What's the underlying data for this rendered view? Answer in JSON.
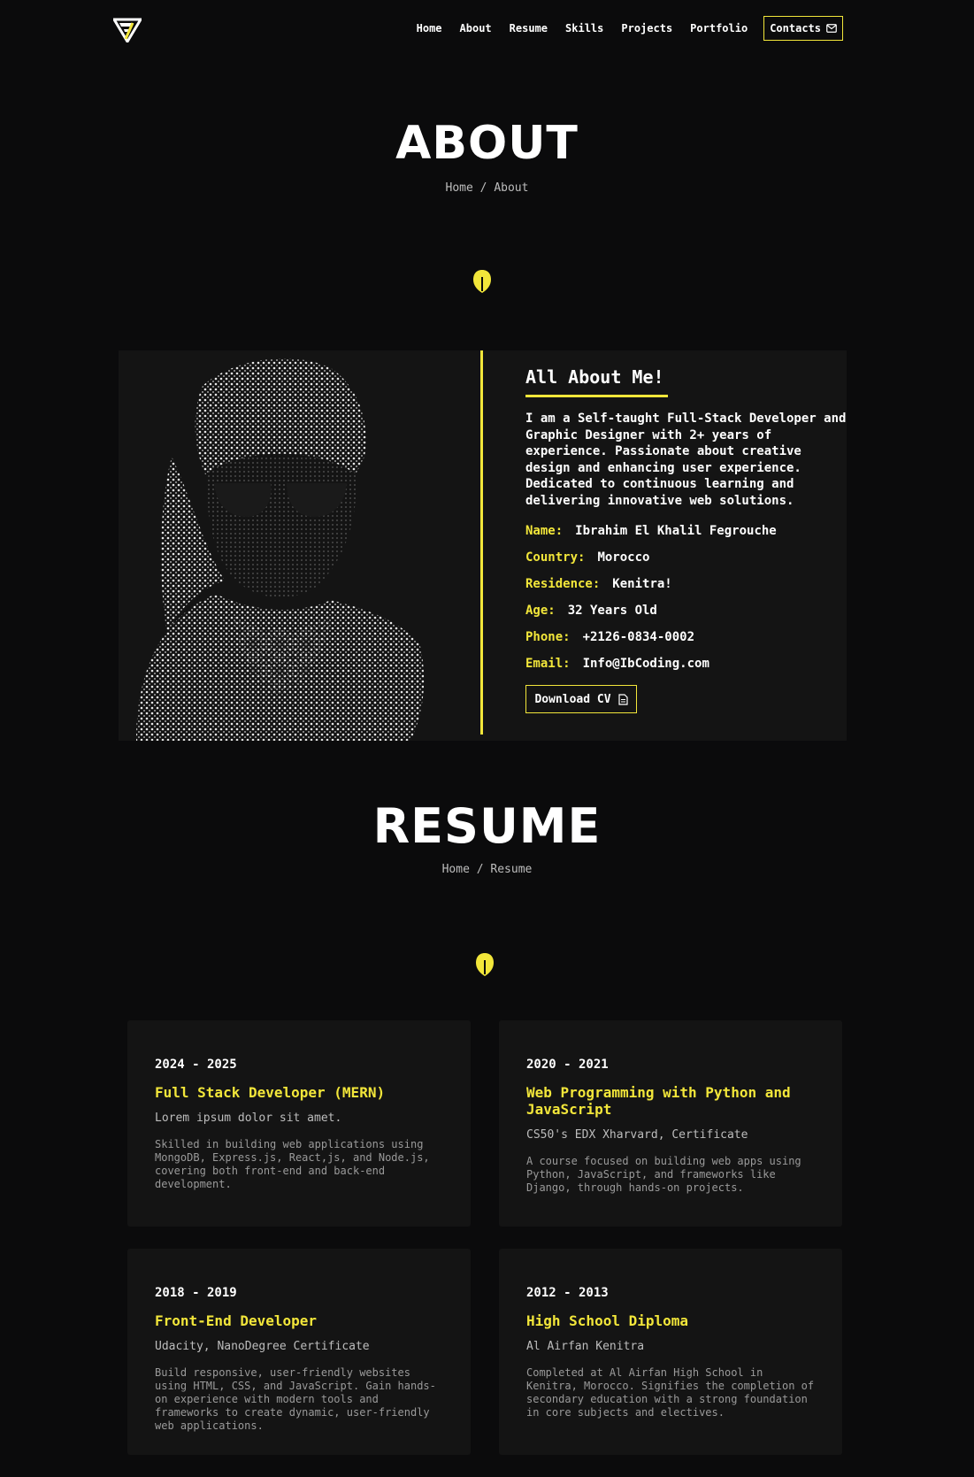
{
  "colors": {
    "accent": "#f2e63a",
    "background": "#0b0b0c",
    "card": "#141414"
  },
  "header": {
    "logo_icon": "fi-triangle-logo",
    "nav": [
      {
        "label": "Home"
      },
      {
        "label": "About"
      },
      {
        "label": "Resume"
      },
      {
        "label": "Skills"
      },
      {
        "label": "Projects"
      },
      {
        "label": "Portfolio"
      }
    ],
    "contacts": {
      "label": "Contacts",
      "icon": "mail-icon"
    }
  },
  "about_section": {
    "title": "ABOUT",
    "breadcrumb": {
      "home": "Home",
      "separator": "/",
      "current": "About"
    },
    "card": {
      "heading": "All About Me!",
      "description": "I am a Self-taught Full-Stack Developer and Graphic Designer with 2+ years of experience. Passionate about creative design and enhancing user experience. Dedicated to continuous learning and delivering innovative web solutions.",
      "info": [
        {
          "key": "Name:",
          "value": "Ibrahim El Khalil Fegrouche"
        },
        {
          "key": "Country:",
          "value": "Morocco"
        },
        {
          "key": "Residence:",
          "value": "Kenitra!"
        },
        {
          "key": "Age:",
          "value": "32 Years Old"
        },
        {
          "key": "Phone:",
          "value": "+2126-0834-0002"
        },
        {
          "key": "Email:",
          "value": "Info@IbCoding.com"
        }
      ],
      "download": {
        "label": "Download CV",
        "icon": "document-icon"
      }
    }
  },
  "resume_section": {
    "title": "RESUME",
    "breadcrumb": {
      "home": "Home",
      "separator": "/",
      "current": "Resume"
    },
    "items": [
      {
        "period": "2024 - 2025",
        "role": "Full Stack Developer (MERN)",
        "org": "Lorem ipsum dolor sit amet.",
        "desc": "Skilled in building web applications using MongoDB, Express.js, React,js, and Node.js, covering both front-end and back-end development."
      },
      {
        "period": "2020 - 2021",
        "role": "Web Programming with Python and JavaScript",
        "org": "CS50's EDX Xharvard, Certificate",
        "desc": "A course focused on building web apps using Python, JavaScript, and frameworks like Django, through hands-on projects."
      },
      {
        "period": "2018 - 2019",
        "role": "Front-End Developer",
        "org": "Udacity, NanoDegree Certificate",
        "desc": "Build responsive, user-friendly websites using HTML, CSS, and JavaScript. Gain hands-on experience with modern tools and frameworks to create dynamic, user-friendly web applications."
      },
      {
        "period": "2012 - 2013",
        "role": "High School Diploma",
        "org": "Al Airfan Kenitra",
        "desc": "Completed at Al Airfan High School in Kenitra, Morocco. Signifies the completion of secondary education with a strong foundation in core subjects and electives."
      }
    ]
  }
}
